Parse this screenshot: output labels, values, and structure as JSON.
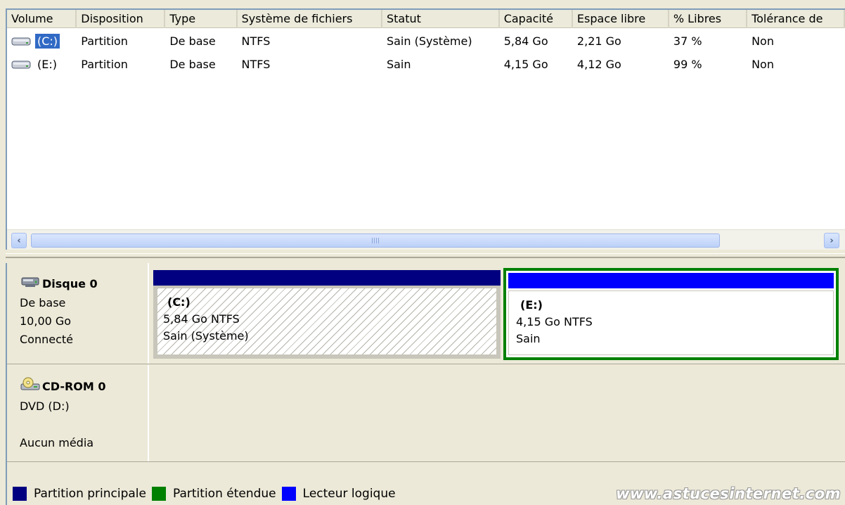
{
  "columns": [
    "Volume",
    "Disposition",
    "Type",
    "Système de fichiers",
    "Statut",
    "Capacité",
    "Espace libre",
    "% Libres",
    "Tolérance de"
  ],
  "volumes": [
    {
      "volume": "(C:)",
      "disposition": "Partition",
      "type": "De base",
      "fs": "NTFS",
      "status": "Sain (Système)",
      "capacity": "5,84 Go",
      "free": "2,21 Go",
      "pct": "37 %",
      "tolerance": "Non",
      "selected": true
    },
    {
      "volume": "(E:)",
      "disposition": "Partition",
      "type": "De base",
      "fs": "NTFS",
      "status": "Sain",
      "capacity": "4,15 Go",
      "free": "4,12 Go",
      "pct": "99 %",
      "tolerance": "Non",
      "selected": false
    }
  ],
  "disks": {
    "disk0": {
      "name": "Disque 0",
      "kind": "De base",
      "size": "10,00 Go",
      "state": "Connecté",
      "partitions": {
        "c": {
          "name": "(C:)",
          "size": "5,84 Go NTFS",
          "status": "Sain (Système)"
        },
        "e": {
          "name": "(E:)",
          "size": "4,15 Go NTFS",
          "status": "Sain"
        }
      }
    },
    "cdrom0": {
      "name": "CD-ROM 0",
      "kind": "DVD (D:)",
      "state": "Aucun média"
    }
  },
  "legend": {
    "primary": "Partition principale",
    "extended": "Partition étendue",
    "logical": "Lecteur logique"
  },
  "watermark": "www.astucesinternet.com",
  "colors": {
    "primary": "#000080",
    "extended": "#008000",
    "logical": "#0000ff",
    "selection": "#316ac5"
  },
  "icons": {
    "drive": "hard-drive-icon",
    "disk": "disk-icon",
    "cdrom": "cdrom-icon"
  }
}
